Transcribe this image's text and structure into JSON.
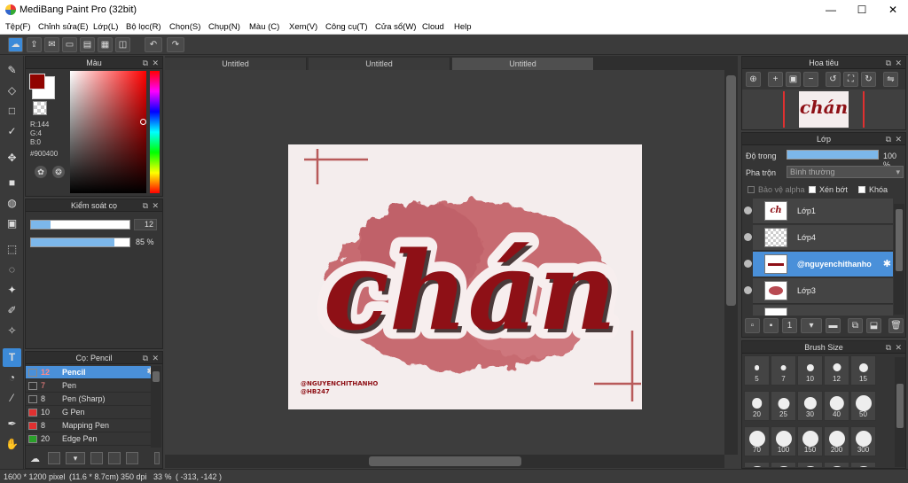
{
  "app": {
    "title": "MediBang Paint Pro (32bit)"
  },
  "menu": [
    "Tệp(F)",
    "Chỉnh sửa(E)",
    "Lớp(L)",
    "Bộ lọc(R)",
    "Chọn(S)",
    "Chụp(N)",
    "Màu (C)",
    "Xem(V)",
    "Công cụ(T)",
    "Cửa sổ(W)",
    "Cloud",
    "Help"
  ],
  "window_controls": {
    "minimize": "—",
    "maximize": "☐",
    "close": "✕"
  },
  "color_panel": {
    "title": "Màu",
    "r": "R:144",
    "g": "G:4",
    "b": "B:0",
    "hex": "#900400",
    "primary": "#900400"
  },
  "brush_control": {
    "title": "Kiểm soát cọ",
    "size": "12",
    "size_pct": 0.2,
    "opacity": "85 %",
    "opacity_pct": 0.85
  },
  "brush_panel": {
    "title": "Cọ: Pencil",
    "items": [
      {
        "size": "12",
        "name": "Pencil",
        "color": "#4a90d9",
        "selected": true
      },
      {
        "size": "7",
        "name": "Pen",
        "color": "#333333"
      },
      {
        "size": "8",
        "name": "Pen (Sharp)",
        "color": "#333333"
      },
      {
        "size": "10",
        "name": "G Pen",
        "color": "#e03030"
      },
      {
        "size": "8",
        "name": "Mapping Pen",
        "color": "#e03030"
      },
      {
        "size": "20",
        "name": "Edge Pen",
        "color": "#2aa02a"
      }
    ]
  },
  "tabs": [
    "Untitled",
    "Untitled",
    "Untitled"
  ],
  "artwork": {
    "main_text": "chán",
    "credit_line1": "@NGUYENCHITHANHO",
    "credit_line2": "@HB247"
  },
  "navigator": {
    "title": "Hoa tiêu",
    "thumb_text": "chán"
  },
  "layer_panel": {
    "title": "Lớp",
    "opacity_label": "Độ trong",
    "opacity_value": "100 %",
    "blend_label": "Pha trộn",
    "blend_value": "Bình thường",
    "protect_alpha": "Bảo vệ alpha",
    "clipping": "Xén bớt",
    "lock": "Khóa",
    "layers": [
      {
        "name": "Lớp1",
        "selected": false
      },
      {
        "name": "Lớp4",
        "selected": false
      },
      {
        "name": "@nguyenchithanho",
        "selected": true
      },
      {
        "name": "Lớp3",
        "selected": false
      }
    ]
  },
  "brush_size_panel": {
    "title": "Brush Size",
    "sizes": [
      "5",
      "7",
      "10",
      "12",
      "15",
      "20",
      "25",
      "30",
      "40",
      "50",
      "70",
      "100",
      "150",
      "200",
      "300"
    ]
  },
  "status": {
    "dimensions": "1600 * 1200 pixel",
    "physical": "(11.6 * 8.7cm)",
    "dpi": "350 dpi",
    "zoom": "33 %",
    "cursor": "( -313, -142 )"
  }
}
